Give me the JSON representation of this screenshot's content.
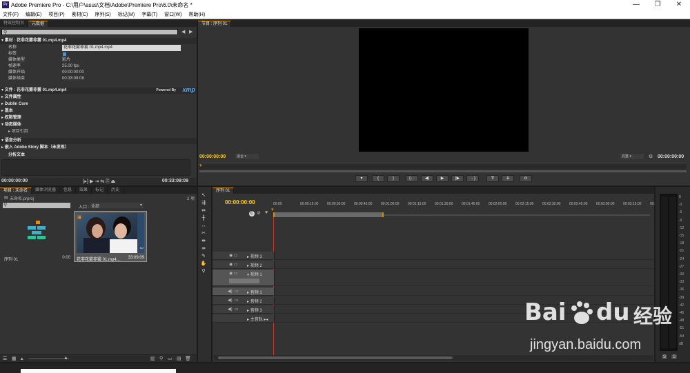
{
  "window": {
    "app_icon": "Pr",
    "title": "Adobe Premiere Pro - C:\\用户\\asus\\文档\\Adobe\\Premiere Pro\\6.0\\未命名 *",
    "min": "—",
    "restore": "❐",
    "close": "✕"
  },
  "menu": [
    "文件(F)",
    "编辑(E)",
    "项目(P)",
    "素材(C)",
    "序列(S)",
    "标记(M)",
    "字幕(T)",
    "窗口(W)",
    "帮助(H)"
  ],
  "meta_panel": {
    "tabs": [
      "特效控制台",
      "元数据"
    ],
    "clip_section": "素材 : 花非花雾非雾 01.mp4.mp4",
    "props": [
      {
        "k": "名称",
        "v": "花非花雾非雾 01.mp4.mp4"
      },
      {
        "k": "标签",
        "v": ""
      },
      {
        "k": "媒体类型",
        "v": "影片"
      },
      {
        "k": "帧速率",
        "v": "25.00 fps"
      },
      {
        "k": "媒体开始",
        "v": "00:00:00:00"
      },
      {
        "k": "媒体结束",
        "v": "00:33:09:08"
      }
    ],
    "file_section": "文件 : 花非花雾非雾 01.mp4.mp4",
    "powered_by": "Powered By",
    "xmp": "xmp",
    "groups": [
      "文件属性",
      "Dublin Core",
      "基本",
      "权限管理",
      "动态媒体"
    ],
    "sub_item": "项目引用",
    "speech_section": "语音分析",
    "story": "嵌入 Adobe Story 脚本（未发现）",
    "analysis_text": "分析文本",
    "tc_left": "00:00:00:00",
    "tc_right": "00:33:09:09"
  },
  "program_monitor": {
    "tab": "节目 : 序列 01",
    "tc_left": "00:00:00:00",
    "fit": "适合",
    "quality": "完整",
    "tc_right": "00:00:00:00"
  },
  "project_panel": {
    "tabs": [
      "项目 : 未命名",
      "媒体浏览器",
      "信息",
      "效果",
      "标记",
      "历史"
    ],
    "project_file": "未命名.prproj",
    "item_count": "2 项",
    "in_label": "入口 :",
    "in_value": "全部",
    "items": [
      {
        "name": "序列 01",
        "dur": "0:00"
      },
      {
        "name": "花非花雾非雾 01.mp4...",
        "dur": "33:09:09"
      }
    ]
  },
  "timeline": {
    "tab": "序列 01",
    "tc": "00:00:00:00",
    "ruler": [
      "00:00",
      "00:00:15:00",
      "00:00:30:00",
      "00:00:45:00",
      "00:01:00:00",
      "00:01:15:00",
      "00:01:30:00",
      "00:01:45:00",
      "00:02:00:00",
      "00:02:15:00",
      "00:02:30:00",
      "00:02:45:00",
      "00:03:00:00",
      "00:03:15:00",
      "00:"
    ],
    "tracks": [
      "视频 3",
      "视频 2",
      "视频 1",
      "音频 1",
      "音频 2",
      "音频 3",
      "主音轨"
    ]
  },
  "audio_meter": {
    "scale": [
      "0",
      "-3",
      "-6",
      "-9",
      "-12",
      "-15",
      "-18",
      "-21",
      "-24",
      "-27",
      "-30",
      "-33",
      "-36",
      "-39",
      "-42",
      "-45",
      "-48",
      "-51",
      "-54",
      "dB"
    ]
  },
  "watermark": {
    "brand": "Bai",
    "brand2": "du",
    "site": "经验",
    "url": "jingyan.baidu.com"
  },
  "colors": {
    "timecode": "#ffcc2a",
    "accent": "#d48a16",
    "playhead": "#c0392b",
    "work_area": "#6a6a6a"
  }
}
